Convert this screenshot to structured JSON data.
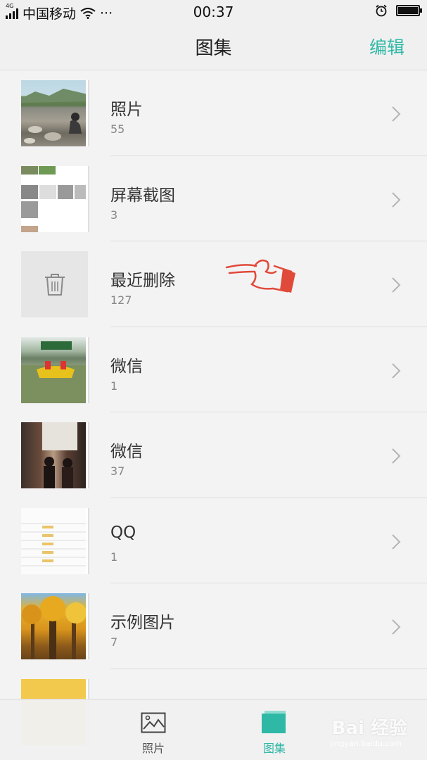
{
  "status_bar": {
    "network_type": "4G",
    "carrier": "中国移动",
    "more": "···",
    "time": "00:37"
  },
  "header": {
    "title": "图集",
    "edit_label": "编辑"
  },
  "albums": [
    {
      "name": "照片",
      "count": "55",
      "thumb": "landscape-photo"
    },
    {
      "name": "屏幕截图",
      "count": "3",
      "thumb": "screenshot-grid"
    },
    {
      "name": "最近删除",
      "count": "127",
      "thumb": "trash-icon"
    },
    {
      "name": "微信",
      "count": "1",
      "thumb": "boat-photo"
    },
    {
      "name": "微信",
      "count": "37",
      "thumb": "people-photo"
    },
    {
      "name": "QQ",
      "count": "1",
      "thumb": "table-screenshot"
    },
    {
      "name": "示例图片",
      "count": "7",
      "thumb": "autumn-trees-photo"
    },
    {
      "name": "",
      "count": "",
      "thumb": "yellow-photo"
    }
  ],
  "tabs": [
    {
      "label": "照片",
      "icon": "image-icon",
      "active": false
    },
    {
      "label": "图集",
      "icon": "album-icon",
      "active": true
    }
  ],
  "watermark": {
    "brand": "Bai 经验",
    "url": "jingyan.baidu.com"
  },
  "colors": {
    "accent": "#2fb8a6",
    "background": "#f4f3f4",
    "bar_background": "#f0f0f0"
  }
}
